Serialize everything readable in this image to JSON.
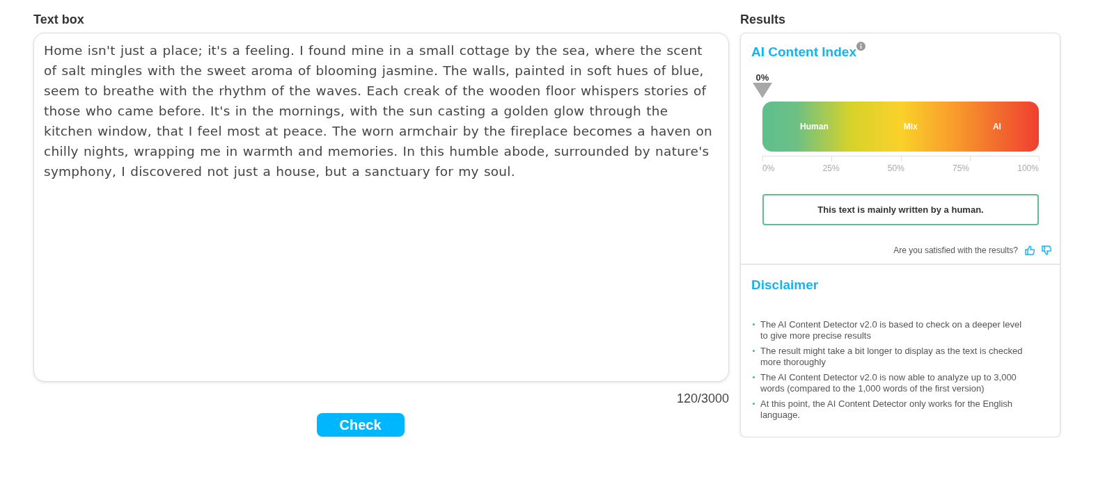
{
  "text_box": {
    "heading": "Text box",
    "value": "Home isn't just a place; it's a feeling. I found mine in a small cottage by the sea, where the scent of salt mingles with the sweet aroma of blooming jasmine. The walls, painted in soft hues of blue, seem to breathe with the rhythm of the waves. Each creak of the wooden floor whispers stories of those who came before. It's in the mornings, with the sun casting a golden glow through the kitchen window, that I feel most at peace. The worn armchair by the fireplace becomes a haven on chilly nights, wrapping me in warmth and memories. In this humble abode, surrounded by nature's symphony, I discovered not just a house, but a sanctuary for my soul.",
    "counter": "120/3000",
    "button": "Check"
  },
  "results": {
    "heading": "Results",
    "index_title": "AI Content Index",
    "gauge": {
      "reading": "0%",
      "zones": [
        "Human",
        "Mix",
        "AI"
      ],
      "ticks": [
        "0%",
        "25%",
        "50%",
        "75%",
        "100%"
      ]
    },
    "verdict": "This text is mainly written by a human.",
    "feedback": "Are you satisfied with the results?",
    "disclaimer_title": "Disclaimer",
    "disclaimer_items": [
      "The AI Content Detector v2.0 is based to check on a deeper level to give more precise results",
      "The result might take a bit longer to display as the text is checked more thoroughly",
      "The AI Content Detector v2.0 is now able to analyze up to 3,000 words (compared to the 1,000 words of the first version)",
      "At this point, the AI Content Detector only works for the English language."
    ]
  }
}
